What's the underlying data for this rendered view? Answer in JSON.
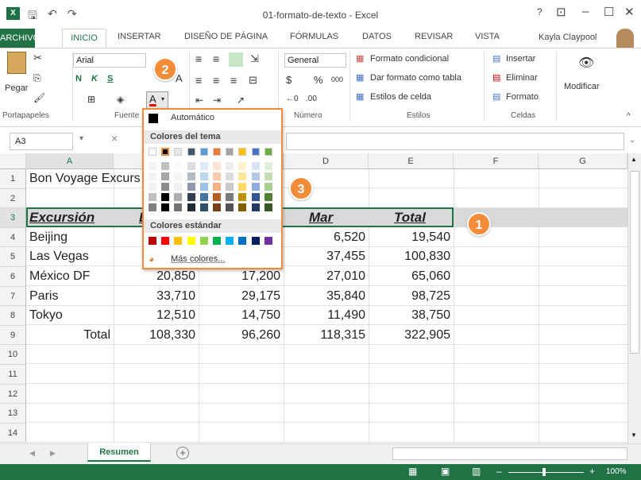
{
  "app": {
    "title": "01-formato-de-texto - Excel",
    "help": "?",
    "user": "Kayla Claypool"
  },
  "tabs": [
    "ARCHIVO",
    "INICIO",
    "INSERTAR",
    "DISEÑO DE PÁGINA",
    "FÓRMULAS",
    "DATOS",
    "REVISAR",
    "VISTA"
  ],
  "ribbon": {
    "paste_label": "Pegar",
    "font_name": "Arial",
    "bold": "N",
    "italic": "K",
    "underline": "S",
    "number_format": "General",
    "currency": "$",
    "percent": "%",
    "thousands": "000",
    "conditional": "Formato condicional",
    "format_table": "Dar formato como tabla",
    "cell_styles": "Estilos de celda",
    "insert": "Insertar",
    "delete": "Eliminar",
    "format": "Formato",
    "modify": "Modificar",
    "groups": {
      "clipboard": "Portapapeles",
      "font": "Fuente",
      "number": "Número",
      "styles": "Estilos",
      "cells": "Celdas"
    }
  },
  "formula_bar": {
    "name_box": "A3",
    "cancel": "×"
  },
  "columns": [
    "A",
    "B",
    "C",
    "D",
    "E",
    "F",
    "G"
  ],
  "rows": [
    {
      "n": "1",
      "cells": [
        "Bon Voyage Excurs",
        "",
        "",
        "",
        "",
        "",
        ""
      ]
    },
    {
      "n": "2",
      "cells": [
        "",
        "",
        "",
        "",
        "",
        "",
        ""
      ]
    },
    {
      "n": "3",
      "cells": [
        "Excursión",
        "E",
        "",
        "Mar",
        "Total",
        "",
        ""
      ]
    },
    {
      "n": "4",
      "cells": [
        "Beijing",
        "",
        "",
        "6,520",
        "19,540",
        "",
        ""
      ]
    },
    {
      "n": "5",
      "cells": [
        "Las Vegas",
        "",
        "",
        "37,455",
        "100,830",
        "",
        ""
      ]
    },
    {
      "n": "6",
      "cells": [
        "México DF",
        "20,850",
        "17,200",
        "27,010",
        "65,060",
        "",
        ""
      ]
    },
    {
      "n": "7",
      "cells": [
        "Paris",
        "33,710",
        "29,175",
        "35,840",
        "98,725",
        "",
        ""
      ]
    },
    {
      "n": "8",
      "cells": [
        "Tokyo",
        "12,510",
        "14,750",
        "11,490",
        "38,750",
        "",
        ""
      ]
    },
    {
      "n": "9",
      "cells": [
        "Total",
        "108,330",
        "96,260",
        "118,315",
        "322,905",
        "",
        ""
      ]
    },
    {
      "n": "10",
      "cells": [
        "",
        "",
        "",
        "",
        "",
        "",
        ""
      ]
    },
    {
      "n": "11",
      "cells": [
        "",
        "",
        "",
        "",
        "",
        "",
        ""
      ]
    },
    {
      "n": "12",
      "cells": [
        "",
        "",
        "",
        "",
        "",
        "",
        ""
      ]
    },
    {
      "n": "13",
      "cells": [
        "",
        "",
        "",
        "",
        "",
        "",
        ""
      ]
    },
    {
      "n": "14",
      "cells": [
        "",
        "",
        "",
        "",
        "",
        "",
        ""
      ]
    }
  ],
  "color_menu": {
    "automatic": "Automático",
    "theme_header": "Colores del tema",
    "standard_header": "Colores estándar",
    "more": "Más colores...",
    "theme_top": [
      "#ffffff",
      "#000000",
      "#e7e6e6",
      "#44546a",
      "#5b9bd5",
      "#ed7d31",
      "#a5a5a5",
      "#ffc000",
      "#4472c4",
      "#70ad47"
    ],
    "standard": [
      "#c00000",
      "#ff0000",
      "#ffc000",
      "#ffff00",
      "#92d050",
      "#00b050",
      "#00b0f0",
      "#0070c0",
      "#002060",
      "#7030a0"
    ]
  },
  "callouts": [
    "1",
    "2",
    "3"
  ],
  "sheet": {
    "tab": "Resumen",
    "add": "+"
  },
  "status": {
    "zoom": "100%"
  }
}
